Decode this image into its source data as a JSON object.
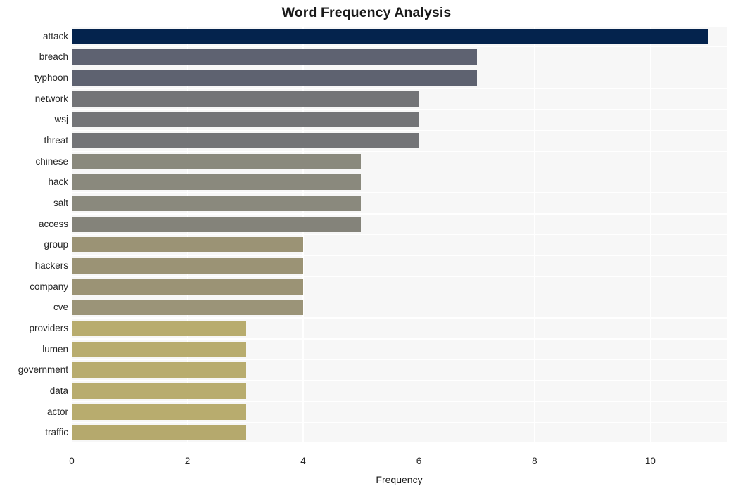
{
  "chart_data": {
    "type": "bar",
    "orientation": "horizontal",
    "title": "Word Frequency Analysis",
    "xlabel": "Frequency",
    "ylabel": "",
    "categories": [
      "attack",
      "breach",
      "typhoon",
      "network",
      "wsj",
      "threat",
      "chinese",
      "hack",
      "salt",
      "access",
      "group",
      "hackers",
      "company",
      "cve",
      "providers",
      "lumen",
      "government",
      "data",
      "actor",
      "traffic"
    ],
    "values": [
      11,
      7,
      7,
      6,
      6,
      6,
      5,
      5,
      5,
      5,
      4,
      4,
      4,
      4,
      3,
      3,
      3,
      3,
      3,
      3
    ],
    "bar_colors": [
      "#04234d",
      "#5e6271",
      "#5e6270",
      "#737477",
      "#737477",
      "#737477",
      "#8a897d",
      "#8a897d",
      "#8a897d",
      "#84837a",
      "#9b9375",
      "#9b9375",
      "#9b9375",
      "#9b9478",
      "#b8ac6e",
      "#b8ac6e",
      "#b8ac6e",
      "#b8ac6e",
      "#b8ac6e",
      "#b5a96d"
    ],
    "xlim": [
      0,
      11.32
    ],
    "ylim_categories": 20,
    "xticks": [
      0,
      2,
      4,
      6,
      8,
      10
    ],
    "xtick_labels": [
      "0",
      "2",
      "4",
      "6",
      "8",
      "10"
    ],
    "grid": true,
    "grid_color": "#ffffff",
    "plot_background": "#f7f7f7",
    "figure_background": "#ffffff",
    "legend": null,
    "annotations": []
  }
}
